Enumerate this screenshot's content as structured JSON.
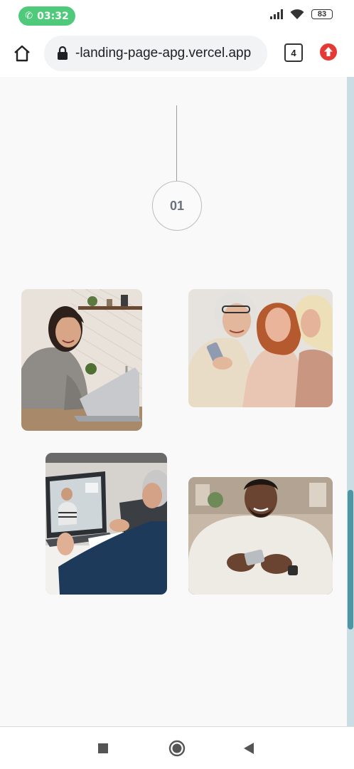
{
  "status_bar": {
    "call_time": "03:32",
    "battery": "83",
    "icons": [
      "phone-icon",
      "signal-icon",
      "wifi-icon",
      "battery-icon"
    ]
  },
  "browser": {
    "url": "-landing-page-apg.vercel.app",
    "tab_count": "4",
    "icons": [
      "home-icon",
      "lock-icon",
      "tabs-icon",
      "update-icon"
    ]
  },
  "page": {
    "step_number": "01",
    "photos": [
      {
        "name": "woman-laptop-kitchen-photo"
      },
      {
        "name": "three-women-phone-photo"
      },
      {
        "name": "video-call-meeting-photo"
      },
      {
        "name": "man-smartphone-photo"
      }
    ]
  },
  "nav": {
    "icons": [
      "recents-square-icon",
      "home-circle-icon",
      "back-triangle-icon"
    ]
  },
  "colors": {
    "call_pill": "#4fc97a",
    "scroll_thumb": "#4e96a3",
    "scroll_track": "#c9dde3",
    "update_badge": "#e53935"
  }
}
